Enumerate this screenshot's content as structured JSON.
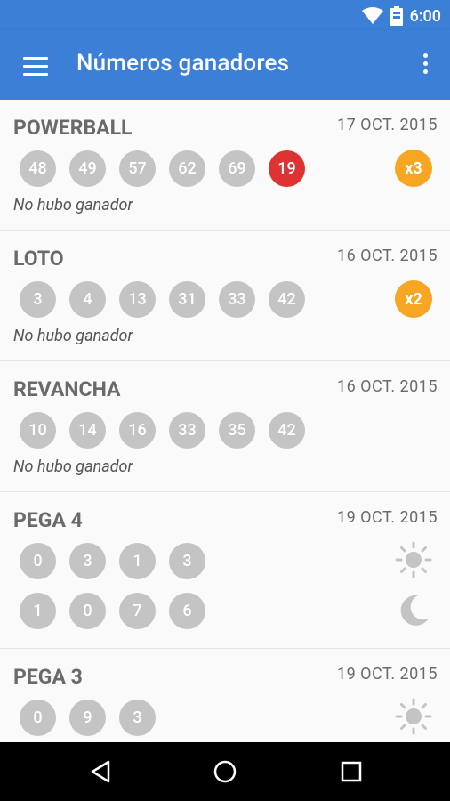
{
  "status_bar": {
    "time": "6:00",
    "icons": [
      "wifi-icon",
      "battery-icon"
    ]
  },
  "app_bar": {
    "title": "Números ganadores",
    "menu_icon": "menu-icon",
    "more_icon": "more-vert-icon"
  },
  "colors": {
    "primary": "#3b7fd6",
    "ball": "#c4c4c4",
    "red_ball": "#dd3333",
    "multiplier": "#f6a623"
  },
  "games": [
    {
      "name": "POWERBALL",
      "date": "17 OCT. 2015",
      "numbers": [
        "48",
        "49",
        "57",
        "62",
        "69"
      ],
      "special": "19",
      "multiplier": "x3",
      "note": "No hubo ganador"
    },
    {
      "name": "LOTO",
      "date": "16 OCT. 2015",
      "numbers": [
        "3",
        "4",
        "13",
        "31",
        "33",
        "42"
      ],
      "multiplier": "x2",
      "note": "No hubo ganador"
    },
    {
      "name": "REVANCHA",
      "date": "16 OCT. 2015",
      "numbers": [
        "10",
        "14",
        "16",
        "33",
        "35",
        "42"
      ],
      "note": "No hubo ganador"
    },
    {
      "name": "PEGA 4",
      "date": "19 OCT. 2015",
      "day_numbers": [
        "0",
        "3",
        "1",
        "3"
      ],
      "night_numbers": [
        "1",
        "0",
        "7",
        "6"
      ],
      "day_icon": "sun-icon",
      "night_icon": "moon-icon"
    },
    {
      "name": "PEGA 3",
      "date": "19 OCT. 2015",
      "day_numbers": [
        "0",
        "9",
        "3"
      ],
      "day_icon": "sun-icon"
    }
  ],
  "nav_bar": {
    "icons": [
      "back-icon",
      "home-icon",
      "recents-icon"
    ]
  }
}
